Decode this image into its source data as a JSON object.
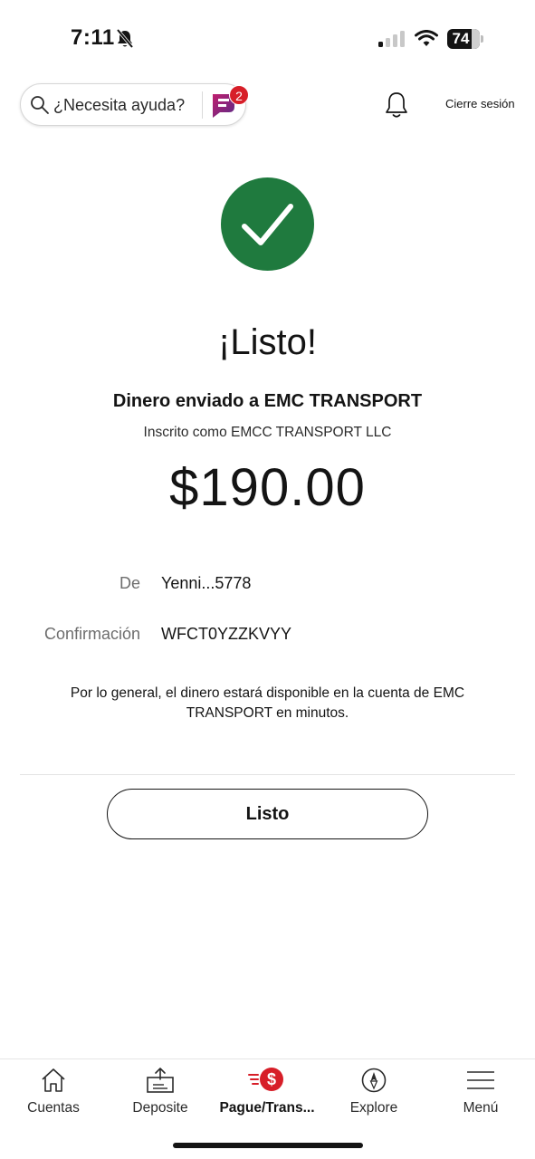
{
  "status_bar": {
    "time": "7:11",
    "battery": "74",
    "battery_level": 0.74
  },
  "header": {
    "search_label": "¿Necesita ayuda?",
    "assistant_badge": "2",
    "logout_label": "Cierre sesión"
  },
  "confirmation": {
    "title": "¡Listo!",
    "recipient_line": "Dinero enviado a EMC  TRANSPORT",
    "enrolled_line": "Inscrito como EMCC TRANSPORT LLC",
    "amount": "$190.00",
    "from_label": "De",
    "from_value": "Yenni...5778",
    "confirmation_label": "Confirmación",
    "confirmation_value": "WFCT0YZZKVYY",
    "note": "Por lo general, el dinero estará disponible en la cuenta de EMC  TRANSPORT en minutos.",
    "done_label": "Listo"
  },
  "nav": {
    "items": [
      {
        "label": "Cuentas",
        "icon": "home-icon"
      },
      {
        "label": "Deposite",
        "icon": "deposit-icon"
      },
      {
        "label": "Pague/Trans...",
        "icon": "pay-transfer-icon"
      },
      {
        "label": "Explore",
        "icon": "compass-icon"
      },
      {
        "label": "Menú",
        "icon": "menu-icon"
      }
    ],
    "active_index": 2
  },
  "colors": {
    "success_green": "#1f7a3e",
    "brand_red": "#d71e28",
    "assistant_purple": "#7b2a7e"
  }
}
